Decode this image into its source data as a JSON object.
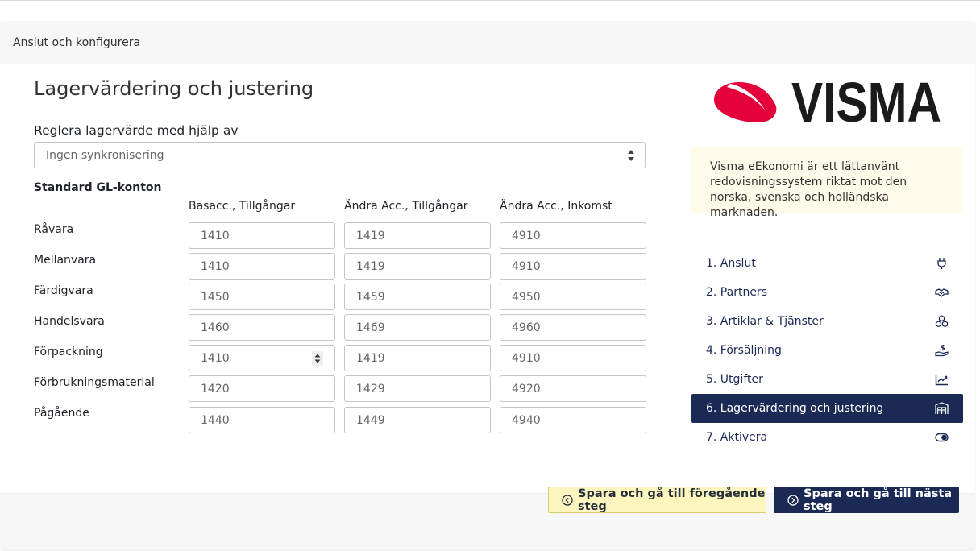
{
  "header": {
    "title": "Anslut och konfigurera"
  },
  "main": {
    "title": "Lagervärdering och justering",
    "sync": {
      "label": "Reglera lagervärde med hjälp av",
      "selected": "Ingen synkronisering"
    },
    "gl": {
      "title": "Standard GL-konton",
      "columns": [
        "Basacc., Tillgångar",
        "Ändra Acc., Tillgångar",
        "Ändra Acc., Inkomst"
      ],
      "rows": [
        {
          "label": "Råvara",
          "values": [
            "1410",
            "1419",
            "4910"
          ]
        },
        {
          "label": "Mellanvara",
          "values": [
            "1410",
            "1419",
            "4910"
          ]
        },
        {
          "label": "Färdigvara",
          "values": [
            "1450",
            "1459",
            "4950"
          ]
        },
        {
          "label": "Handelsvara",
          "values": [
            "1460",
            "1469",
            "4960"
          ]
        },
        {
          "label": "Förpackning",
          "values": [
            "1410",
            "1419",
            "4910"
          ]
        },
        {
          "label": "Förbrukningsmaterial",
          "values": [
            "1420",
            "1429",
            "4920"
          ]
        },
        {
          "label": "Pågående",
          "values": [
            "1440",
            "1449",
            "4940"
          ]
        }
      ]
    }
  },
  "sidebar": {
    "logo_text": "VISMA",
    "info": "Visma eEkonomi är ett lättanvänt redovisningssystem riktat mot den norska, svenska och holländska marknaden.",
    "steps": [
      {
        "label": "1. Anslut",
        "icon": "plug-icon"
      },
      {
        "label": "2. Partners",
        "icon": "handshake-icon"
      },
      {
        "label": "3. Artiklar & Tjänster",
        "icon": "cubes-icon"
      },
      {
        "label": "4. Försäljning",
        "icon": "hand-dollar-icon"
      },
      {
        "label": "5. Utgifter",
        "icon": "chart-line-icon"
      },
      {
        "label": "6. Lagervärdering och justering",
        "icon": "warehouse-icon"
      },
      {
        "label": "7. Aktivera",
        "icon": "toggle-icon"
      }
    ],
    "active_step": 6
  },
  "footer": {
    "prev_label": "Spara och gå till föregående steg",
    "next_label": "Spara och gå till nästa steg"
  },
  "colors": {
    "navy": "#1b2a55",
    "visma_red": "#e4003a",
    "info_bg": "#fffbea",
    "prev_bg": "#fdf6bf"
  }
}
